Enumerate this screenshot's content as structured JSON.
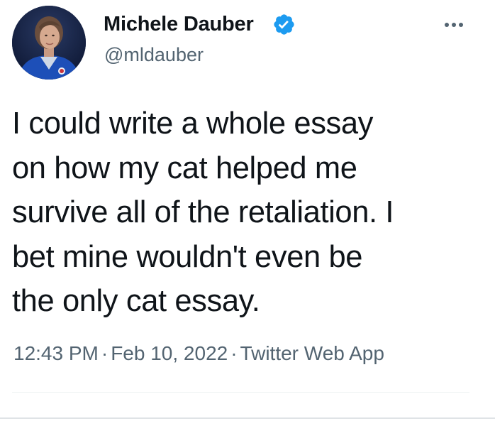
{
  "author": {
    "display_name": "Michele Dauber",
    "handle": "@mldauber",
    "verified": true
  },
  "tweet": {
    "text": "I could write a whole essay\non how my cat helped me\nsurvive all of the retaliation. I\nbet mine wouldn't even be\nthe only cat essay.",
    "time": "12:43 PM",
    "date": "Feb 10, 2022",
    "source": "Twitter Web App",
    "separator": "·"
  },
  "icons": {
    "verified": "verified-badge-icon",
    "more": "more-options-icon"
  },
  "colors": {
    "verified_blue": "#1d9bf0",
    "text_primary": "#0f1419",
    "text_secondary": "#536471",
    "divider": "#eff3f4"
  }
}
